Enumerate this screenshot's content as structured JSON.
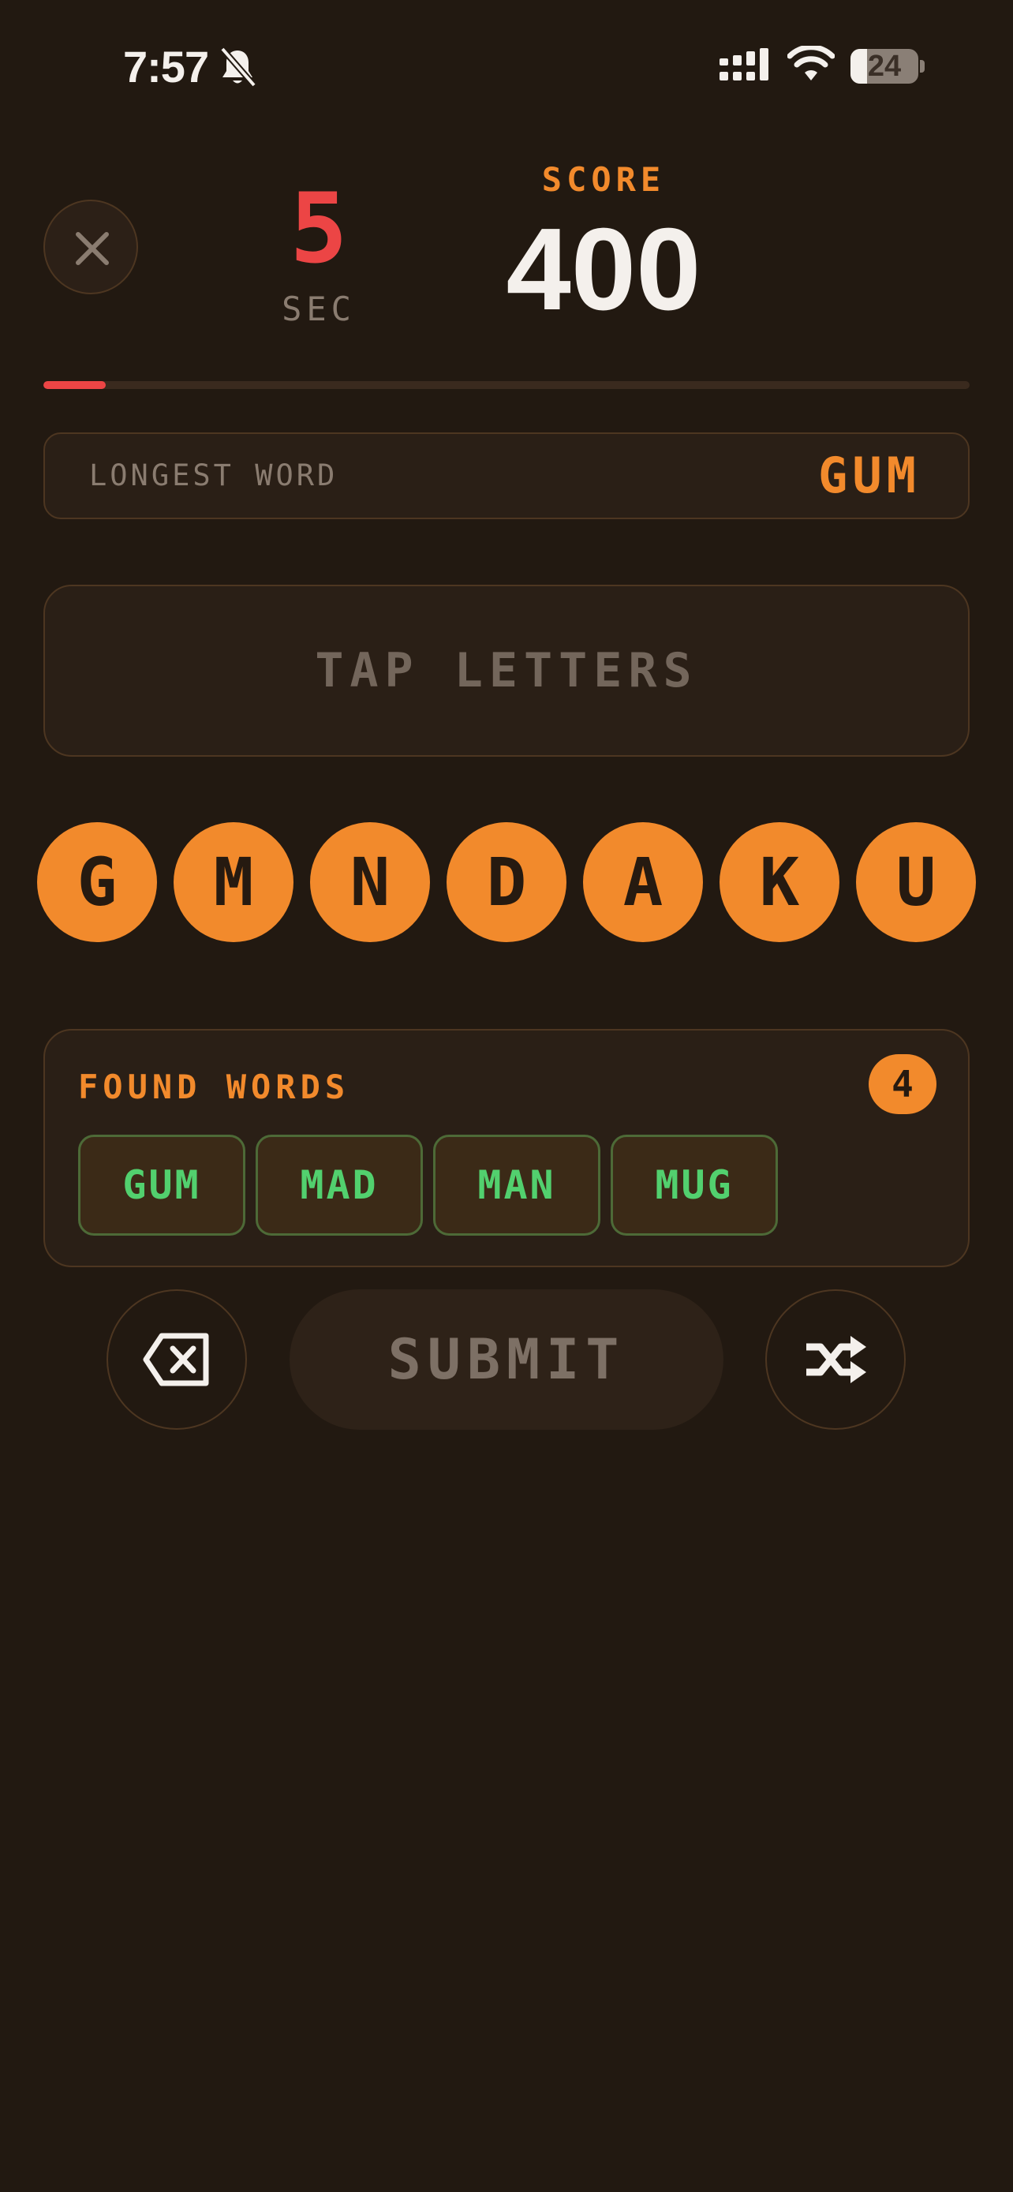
{
  "status_bar": {
    "time": "7:57",
    "battery_level": "24",
    "battery_fraction": 0.24,
    "icons": [
      "bell-slash-icon",
      "cellular-signal-icon",
      "wifi-icon",
      "battery-icon"
    ]
  },
  "header": {
    "close_icon": "close-icon",
    "timer_value": "5",
    "timer_unit": "SEC",
    "score_label": "SCORE",
    "score_value": "400",
    "time_progress_fraction": 0.067
  },
  "longest_word": {
    "label": "LONGEST WORD",
    "value": "GUM"
  },
  "word_area": {
    "placeholder": "TAP LETTERS"
  },
  "letters": [
    "G",
    "M",
    "N",
    "D",
    "A",
    "K",
    "U"
  ],
  "found_words": {
    "title": "FOUND WORDS",
    "count": "4",
    "words": [
      "GUM",
      "MAD",
      "MAN",
      "MUG"
    ]
  },
  "controls": {
    "backspace_icon": "backspace-icon",
    "submit_label": "SUBMIT",
    "shuffle_icon": "shuffle-icon"
  },
  "colors": {
    "background": "#221911",
    "accent": "#f28a2c",
    "timer": "#ec4545",
    "found_word_text": "#52d06e"
  }
}
